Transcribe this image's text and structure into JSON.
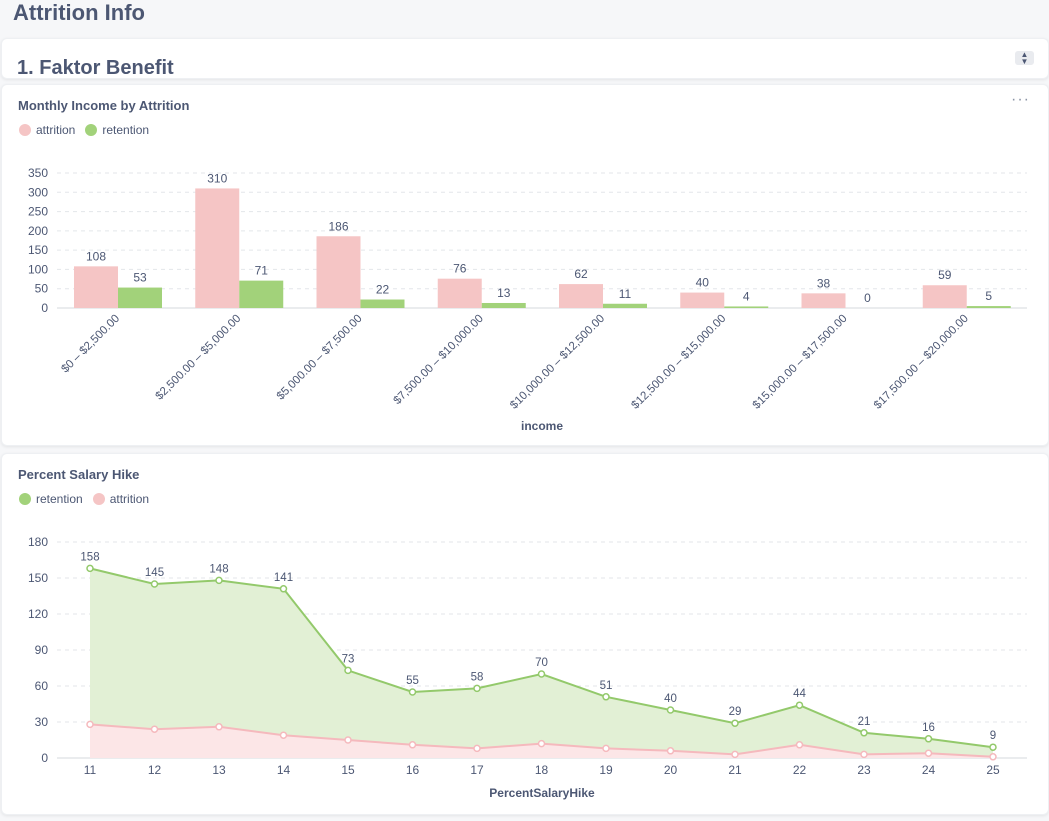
{
  "page": {
    "title": "Attrition Info",
    "section_heading": "1. Faktor Benefit"
  },
  "icons": {
    "more": "more-horizontal-icon",
    "scroll": "up-down-chevron-icon"
  },
  "colors": {
    "attrition": "#f5c5c5",
    "retention": "#a2d27a",
    "attrition_line": "#f5b9bd",
    "retention_line": "#93c96b"
  },
  "chart_data": [
    {
      "type": "bar",
      "title": "Monthly Income by Attrition",
      "xlabel": "income",
      "ylabel": "",
      "ylim": [
        0,
        350
      ],
      "yticks": [
        0,
        50,
        100,
        150,
        200,
        250,
        300,
        350
      ],
      "legend_position": "top-left",
      "grid": true,
      "categories": [
        "$0 – $2,500.00",
        "$2,500.00 – $5,000.00",
        "$5,000.00 – $7,500.00",
        "$7,500.00 – $10,000.00",
        "$10,000.00 – $12,500.00",
        "$12,500.00 – $15,000.00",
        "$15,000.00 – $17,500.00",
        "$17,500.00 – $20,000.00"
      ],
      "series": [
        {
          "name": "attrition",
          "values": [
            108,
            310,
            186,
            76,
            62,
            40,
            38,
            59
          ]
        },
        {
          "name": "retention",
          "values": [
            53,
            71,
            22,
            13,
            11,
            4,
            0,
            5
          ]
        }
      ]
    },
    {
      "type": "area",
      "title": "Percent Salary Hike",
      "xlabel": "PercentSalaryHike",
      "ylabel": "",
      "ylim": [
        0,
        180
      ],
      "yticks": [
        0,
        30,
        60,
        90,
        120,
        150,
        180
      ],
      "legend_position": "top-left",
      "grid": true,
      "x": [
        11,
        12,
        13,
        14,
        15,
        16,
        17,
        18,
        19,
        20,
        21,
        22,
        23,
        24,
        25
      ],
      "series": [
        {
          "name": "retention",
          "values": [
            158,
            145,
            148,
            141,
            73,
            55,
            58,
            70,
            51,
            40,
            29,
            44,
            21,
            16,
            9
          ]
        },
        {
          "name": "attrition",
          "values": [
            28,
            24,
            26,
            19,
            15,
            11,
            8,
            12,
            8,
            6,
            3,
            11,
            3,
            4,
            1
          ]
        }
      ]
    }
  ]
}
